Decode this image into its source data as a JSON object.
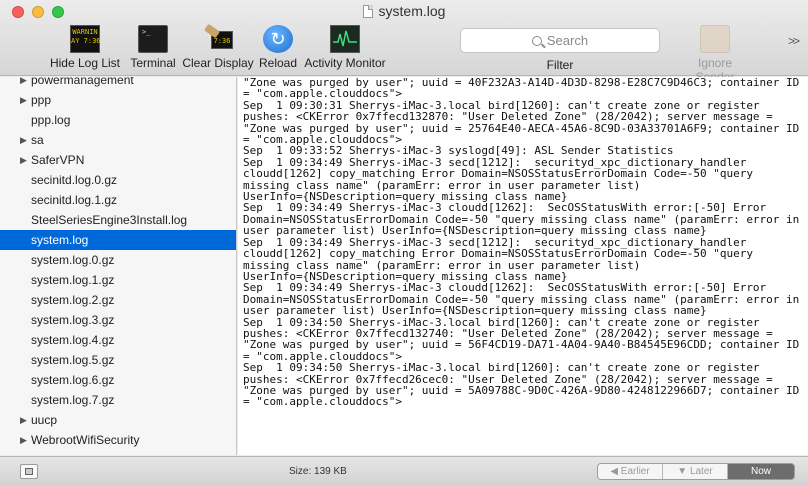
{
  "window": {
    "title": "system.log"
  },
  "toolbar": {
    "hide_log_list": "Hide Log List",
    "terminal": "Terminal",
    "clear_display": "Clear Display",
    "reload": "Reload",
    "activity_monitor": "Activity Monitor",
    "search_placeholder": "Search",
    "filter": "Filter",
    "ignore_sender": "Ignore Sender",
    "log_icon_text": "WARNIN\nAY 7:36",
    "clear_icon_text": "7:36",
    "overflow": ">>"
  },
  "sidebar": {
    "items": [
      {
        "label": "powermanagement",
        "expandable": true
      },
      {
        "label": "ppp",
        "expandable": true
      },
      {
        "label": "ppp.log",
        "expandable": false
      },
      {
        "label": "sa",
        "expandable": true
      },
      {
        "label": "SaferVPN",
        "expandable": true
      },
      {
        "label": "secinitd.log.0.gz",
        "expandable": false
      },
      {
        "label": "secinitd.log.1.gz",
        "expandable": false
      },
      {
        "label": "SteelSeriesEngine3Install.log",
        "expandable": false
      },
      {
        "label": "system.log",
        "expandable": false,
        "selected": true
      },
      {
        "label": "system.log.0.gz",
        "expandable": false
      },
      {
        "label": "system.log.1.gz",
        "expandable": false
      },
      {
        "label": "system.log.2.gz",
        "expandable": false
      },
      {
        "label": "system.log.3.gz",
        "expandable": false
      },
      {
        "label": "system.log.4.gz",
        "expandable": false
      },
      {
        "label": "system.log.5.gz",
        "expandable": false
      },
      {
        "label": "system.log.6.gz",
        "expandable": false
      },
      {
        "label": "system.log.7.gz",
        "expandable": false
      },
      {
        "label": "uucp",
        "expandable": true
      },
      {
        "label": "WebrootWifiSecurity",
        "expandable": true
      }
    ]
  },
  "log": {
    "lines": [
      "\"Zone was purged by user\"; uuid = 40F232A3-A14D-4D3D-8298-E28C7C9D46C3; container ID",
      "= \"com.apple.clouddocs\">",
      "Sep  1 09:30:31 Sherrys-iMac-3.local bird[1260]: can't create zone or register",
      "pushes: <CKError 0x7ffecd132870: \"User Deleted Zone\" (28/2042); server message =",
      "\"Zone was purged by user\"; uuid = 25764E40-AECA-45A6-8C9D-03A33701A6F9; container ID",
      "= \"com.apple.clouddocs\">",
      "Sep  1 09:33:52 Sherrys-iMac-3 syslogd[49]: ASL Sender Statistics",
      "Sep  1 09:34:49 Sherrys-iMac-3 secd[1212]:  securityd_xpc_dictionary_handler",
      "cloudd[1262] copy_matching Error Domain=NSOSStatusErrorDomain Code=-50 \"query",
      "missing class name\" (paramErr: error in user parameter list)",
      "UserInfo={NSDescription=query missing class name}",
      "Sep  1 09:34:49 Sherrys-iMac-3 cloudd[1262]:  SecOSStatusWith error:[-50] Error",
      "Domain=NSOSStatusErrorDomain Code=-50 \"query missing class name\" (paramErr: error in",
      "user parameter list) UserInfo={NSDescription=query missing class name}",
      "Sep  1 09:34:49 Sherrys-iMac-3 secd[1212]:  securityd_xpc_dictionary_handler",
      "cloudd[1262] copy_matching Error Domain=NSOSStatusErrorDomain Code=-50 \"query",
      "missing class name\" (paramErr: error in user parameter list)",
      "UserInfo={NSDescription=query missing class name}",
      "Sep  1 09:34:49 Sherrys-iMac-3 cloudd[1262]:  SecOSStatusWith error:[-50] Error",
      "Domain=NSOSStatusErrorDomain Code=-50 \"query missing class name\" (paramErr: error in",
      "user parameter list) UserInfo={NSDescription=query missing class name}",
      "Sep  1 09:34:50 Sherrys-iMac-3.local bird[1260]: can't create zone or register",
      "pushes: <CKError 0x7ffecd132740: \"User Deleted Zone\" (28/2042); server message =",
      "\"Zone was purged by user\"; uuid = 56F4CD19-DA71-4A04-9A40-B84545E96CDD; container ID",
      "= \"com.apple.clouddocs\">",
      "Sep  1 09:34:50 Sherrys-iMac-3.local bird[1260]: can't create zone or register",
      "pushes: <CKError 0x7ffecd26cec0: \"User Deleted Zone\" (28/2042); server message =",
      "\"Zone was purged by user\"; uuid = 5A09788C-9D0C-426A-9D80-4248122966D7; container ID",
      "= \"com.apple.clouddocs\">"
    ]
  },
  "status": {
    "size": "Size: 139 KB",
    "earlier": "Earlier",
    "later": "Later",
    "now": "Now"
  }
}
